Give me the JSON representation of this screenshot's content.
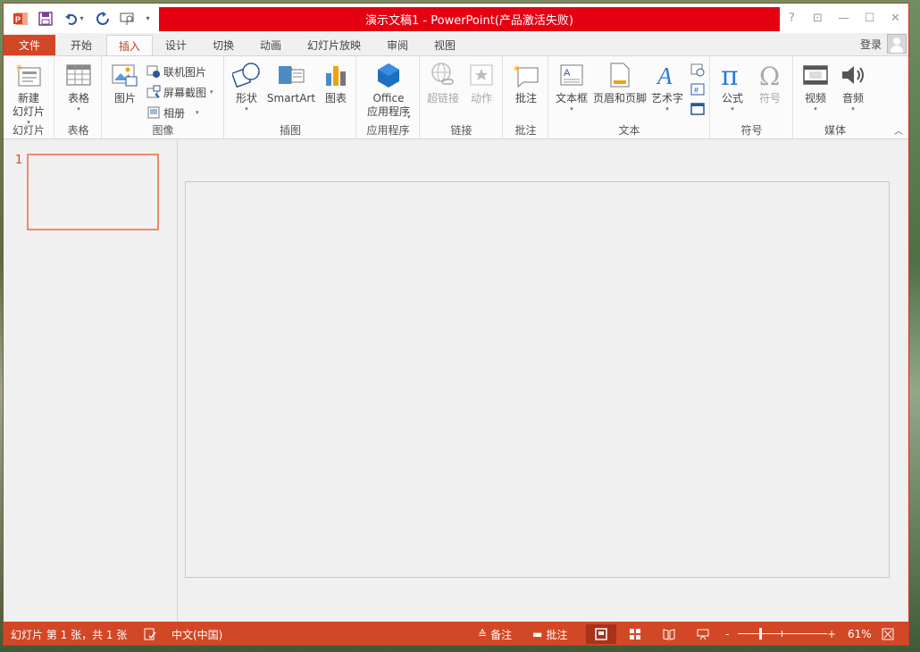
{
  "title": "演示文稿1 - PowerPoint(产品激活失败)",
  "window_controls": {
    "help": "?",
    "restore_ribbon": "⊡",
    "minimize": "—",
    "maximize": "☐",
    "close": "✕"
  },
  "tabs": {
    "file": "文件",
    "home": "开始",
    "insert": "插入",
    "design": "设计",
    "transitions": "切换",
    "animations": "动画",
    "slideshow": "幻灯片放映",
    "review": "审阅",
    "view": "视图"
  },
  "login": "登录",
  "ribbon": {
    "slides": {
      "label": "幻灯片",
      "new_slide": "新建\n幻灯片"
    },
    "tables": {
      "label": "表格",
      "table": "表格"
    },
    "images": {
      "label": "图像",
      "pictures": "图片",
      "online_pictures": "联机图片",
      "screenshot": "屏幕截图",
      "album": "相册"
    },
    "illustrations": {
      "label": "插图",
      "shapes": "形状",
      "smartart": "SmartArt",
      "chart": "图表"
    },
    "apps": {
      "label": "应用程序",
      "office_apps": "Office\n应用程序"
    },
    "links": {
      "label": "链接",
      "hyperlink": "超链接",
      "action": "动作"
    },
    "comments": {
      "label": "批注",
      "comment": "批注"
    },
    "text": {
      "label": "文本",
      "textbox": "文本框",
      "header_footer": "页眉和页脚",
      "wordart": "艺术字"
    },
    "symbols": {
      "label": "符号",
      "equation": "公式",
      "symbol": "符号"
    },
    "media": {
      "label": "媒体",
      "video": "视频",
      "audio": "音频"
    }
  },
  "slides_pane": {
    "slide_number": "1"
  },
  "status": {
    "slide_info": "幻灯片 第 1 张，共 1 张",
    "language": "中文(中国)",
    "notes": "备注",
    "comments": "批注",
    "zoom_minus": "-",
    "zoom_plus": "+",
    "zoom": "61%"
  },
  "colors": {
    "accent": "#d24726",
    "title_red": "#e50012",
    "active_tab_text": "#c43e1c"
  }
}
